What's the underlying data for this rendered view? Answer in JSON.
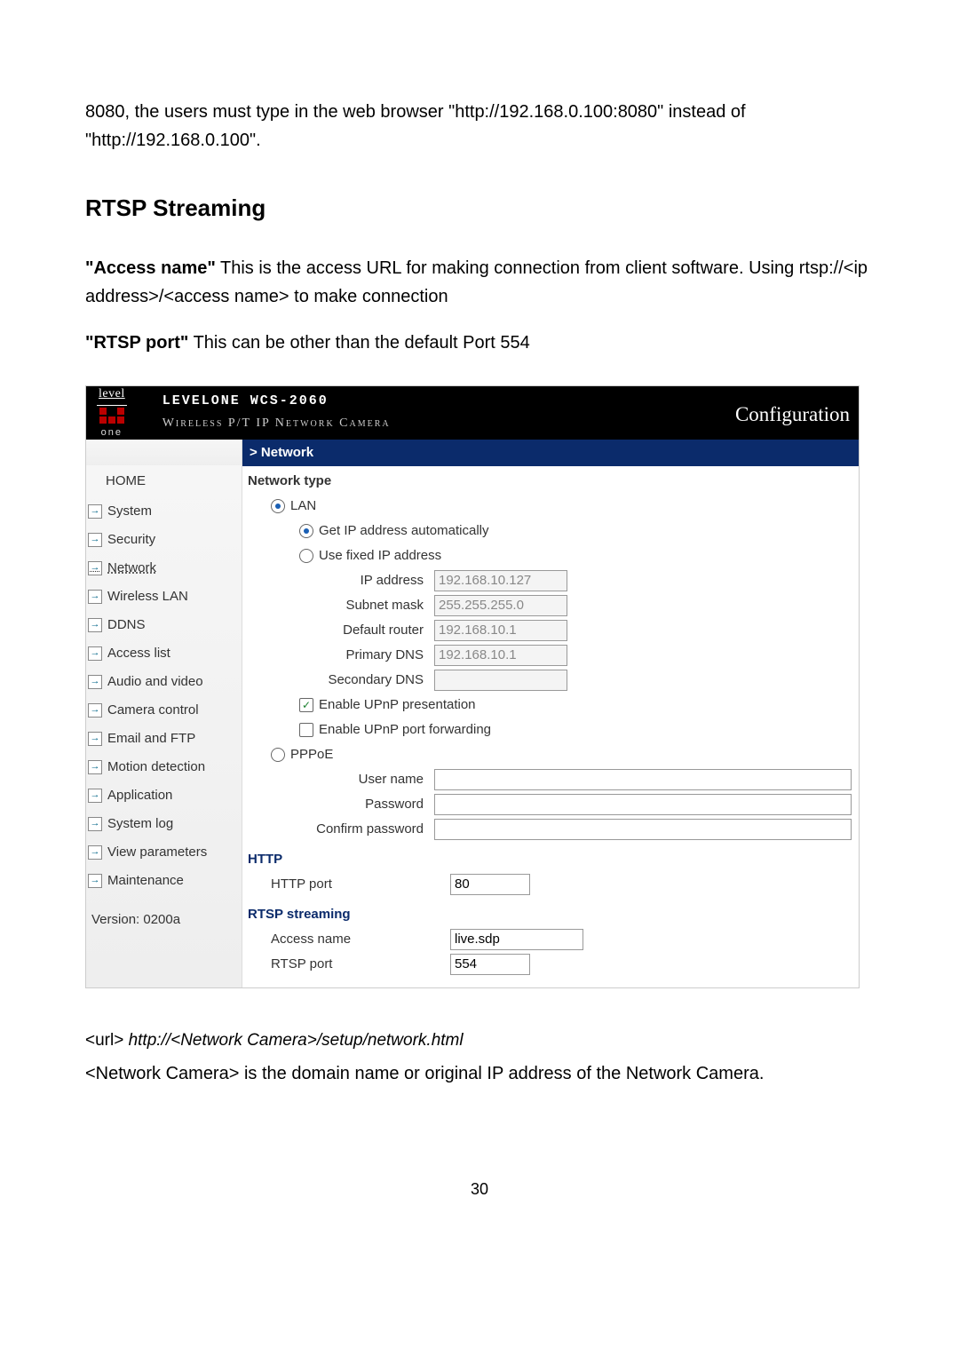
{
  "doc": {
    "intro": "8080, the users must type in the web browser \"http://192.168.0.100:8080\" instead of \"http://192.168.0.100\".",
    "heading": "RTSP Streaming",
    "p1_bold": "\"Access name\"",
    "p1_rest": " This is the access URL for making connection from client software. Using rtsp://<ip address>/<access name> to make connection",
    "p2_bold": "\"RTSP port\"",
    "p2_rest": " This can be other than the default Port 554",
    "url_label": "<url>",
    "url_ital": " http://<Network Camera>/setup/network.html",
    "url_desc": "<Network Camera> is the domain name or original IP address of the Network Camera.",
    "page_number": "30"
  },
  "ui": {
    "logo": {
      "top": "level",
      "sub": "one"
    },
    "header": {
      "line1": "LEVELONE WCS-2060",
      "line2": "Wireless P/T IP Network Camera",
      "right": "Configuration"
    },
    "breadcrumb": "> Network",
    "sidebar": {
      "home": "HOME",
      "items": [
        "System",
        "Security",
        "Network",
        "Wireless LAN",
        "DDNS",
        "Access list",
        "Audio and video",
        "Camera control",
        "Email and FTP",
        "Motion detection",
        "Application",
        "System log",
        "View parameters",
        "Maintenance"
      ],
      "version": "Version: 0200a"
    },
    "form": {
      "section_network_type": "Network type",
      "lan_label": "LAN",
      "auto_label": "Get IP address automatically",
      "fixed_label": "Use fixed IP address",
      "ip_label": "IP address",
      "ip_val": "192.168.10.127",
      "subnet_label": "Subnet mask",
      "subnet_val": "255.255.255.0",
      "router_label": "Default router",
      "router_val": "192.168.10.1",
      "pdns_label": "Primary DNS",
      "pdns_val": "192.168.10.1",
      "sdns_label": "Secondary DNS",
      "sdns_val": "",
      "upnp_pres": "Enable UPnP presentation",
      "upnp_port": "Enable UPnP port forwarding",
      "pppoe_label": "PPPoE",
      "user_label": "User name",
      "pass_label": "Password",
      "cpass_label": "Confirm password",
      "section_http": "HTTP",
      "http_port_label": "HTTP port",
      "http_port_val": "80",
      "section_rtsp": "RTSP streaming",
      "access_label": "Access name",
      "access_val": "live.sdp",
      "rtsp_port_label": "RTSP port",
      "rtsp_port_val": "554"
    }
  }
}
